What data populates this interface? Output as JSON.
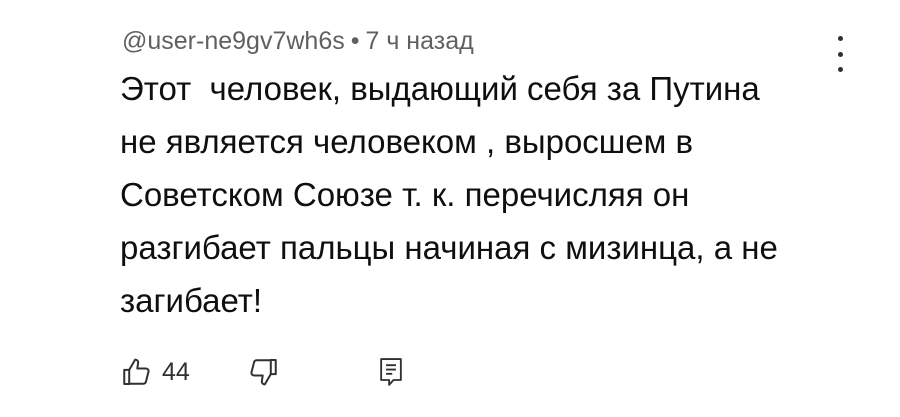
{
  "comment": {
    "author": "@user-ne9gv7wh6s",
    "separator": "•",
    "time": "7 ч назад",
    "text": "Этот  человек, выдающий себя за Путина\nне является человеком , выросшем в\nСоветском Союзе т. к. перечисляя он\nразгибает пальцы начиная с мизинца, а не\nзагибает!",
    "like_count": "44"
  },
  "icons": {
    "menu": "more-vert-icon",
    "like": "thumb-up-icon",
    "dislike": "thumb-down-icon",
    "reply": "reply-comment-icon"
  }
}
